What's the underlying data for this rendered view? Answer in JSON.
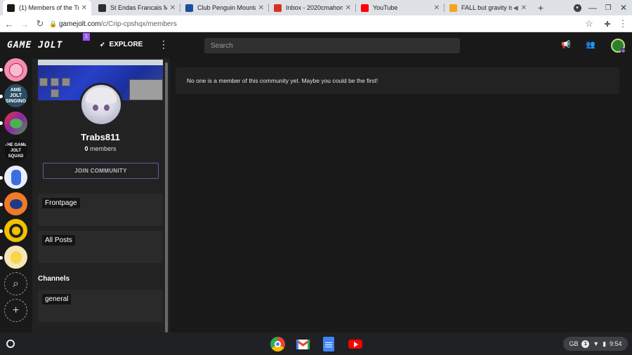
{
  "browser": {
    "tabs": [
      {
        "title": "(1) Members of the Tra",
        "color": "#1b1b1b",
        "active": true
      },
      {
        "title": "St Endas Francais Mr S",
        "color": "#2d2d2d",
        "active": false
      },
      {
        "title": "Club Penguin Mountai",
        "color": "#1c4e9c",
        "active": false
      },
      {
        "title": "Inbox - 2020cmahon@",
        "color": "#d93025",
        "active": false
      },
      {
        "title": "YouTube",
        "color": "#ff0000",
        "active": false
      },
      {
        "title": "FALL but gravity is",
        "color": "#f6a31a",
        "active": false
      }
    ],
    "new_tab": "+",
    "url_host": "gamejolt.com",
    "url_path": "/c/Crip-cpshqx/members"
  },
  "gj": {
    "logo": "GAME JOLT",
    "badge": "1",
    "explore": "EXPLORE",
    "search_placeholder": "Search"
  },
  "rail": [
    {
      "label": "",
      "color": "#f48fb1",
      "active": true
    },
    {
      "label": "AME JOLT SINGING",
      "color": "#2b4c63",
      "active": true
    },
    {
      "label": "",
      "color": "#6b3fa0",
      "active": true
    },
    {
      "label": "THE GAME JOLT SQUAD",
      "color": "#111111",
      "active": false
    },
    {
      "label": "",
      "color": "#e8eefc",
      "active": true
    },
    {
      "label": "",
      "color": "#f07a27",
      "active": true
    },
    {
      "label": "",
      "color": "#f2c200",
      "active": true
    },
    {
      "label": "",
      "color": "#f4e6b8",
      "active": true
    }
  ],
  "community": {
    "name": "Trabs811",
    "member_count": "0",
    "members_label": "members",
    "join_label": "JOIN COMMUNITY",
    "nav": [
      "Frontpage",
      "All Posts"
    ],
    "channels_heading": "Channels",
    "channels": [
      "general"
    ]
  },
  "main": {
    "empty_message": "No one is a member of this community yet. Maybe you could be the first!"
  },
  "shelf": {
    "locale": "GB",
    "notif_count": "1",
    "time": "9:54"
  }
}
